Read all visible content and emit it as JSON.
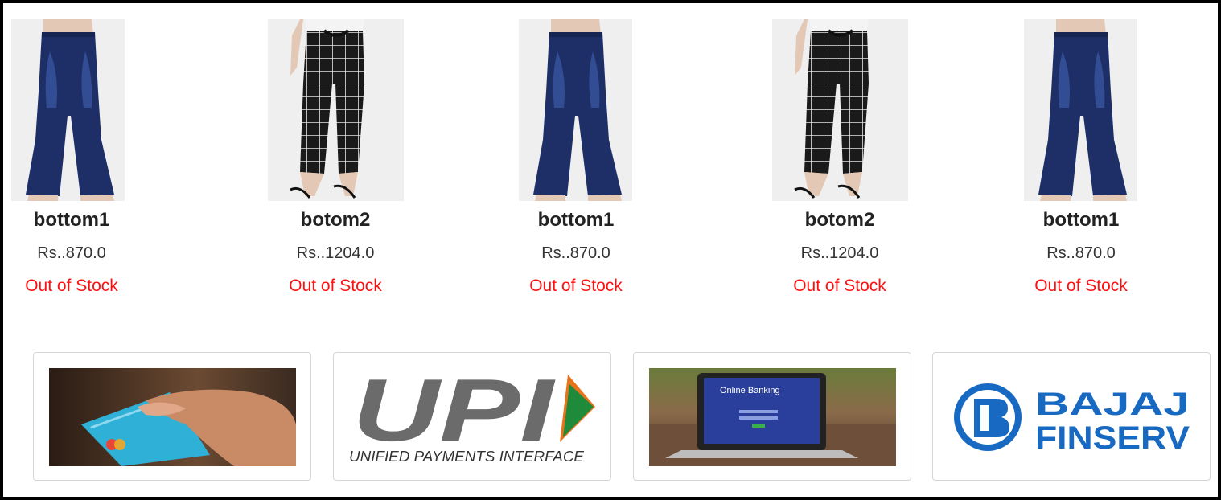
{
  "products": [
    {
      "name": "bottom1",
      "price": "Rs..870.0",
      "status": "Out of Stock",
      "image": "flared-jeans-image"
    },
    {
      "name": "botom2",
      "price": "Rs..1204.0",
      "status": "Out of Stock",
      "image": "checked-trousers-image"
    },
    {
      "name": "bottom1",
      "price": "Rs..870.0",
      "status": "Out of Stock",
      "image": "flared-jeans-image"
    },
    {
      "name": "botom2",
      "price": "Rs..1204.0",
      "status": "Out of Stock",
      "image": "checked-trousers-image"
    },
    {
      "name": "bottom1",
      "price": "Rs..870.0",
      "status": "Out of Stock",
      "image": "flared-jeans-image"
    }
  ],
  "payments": [
    {
      "name": "credit-card",
      "image": "card-in-hand-image"
    },
    {
      "name": "upi",
      "logo_text": "UPI",
      "caption": "UNIFIED PAYMENTS INTERFACE"
    },
    {
      "name": "net-banking",
      "screen_text": "Online Banking"
    },
    {
      "name": "bajaj-finserv",
      "line1": "BAJAJ",
      "line2": "FINSERV"
    }
  ],
  "colors": {
    "out_of_stock": "#ff1010",
    "denim": "#1d2f66",
    "upi_grey": "#6b6b6b",
    "upi_orange": "#e8731c",
    "upi_green": "#1f8a3a",
    "bajaj_blue": "#1769c1",
    "bank_screen": "#2a3f9c"
  }
}
